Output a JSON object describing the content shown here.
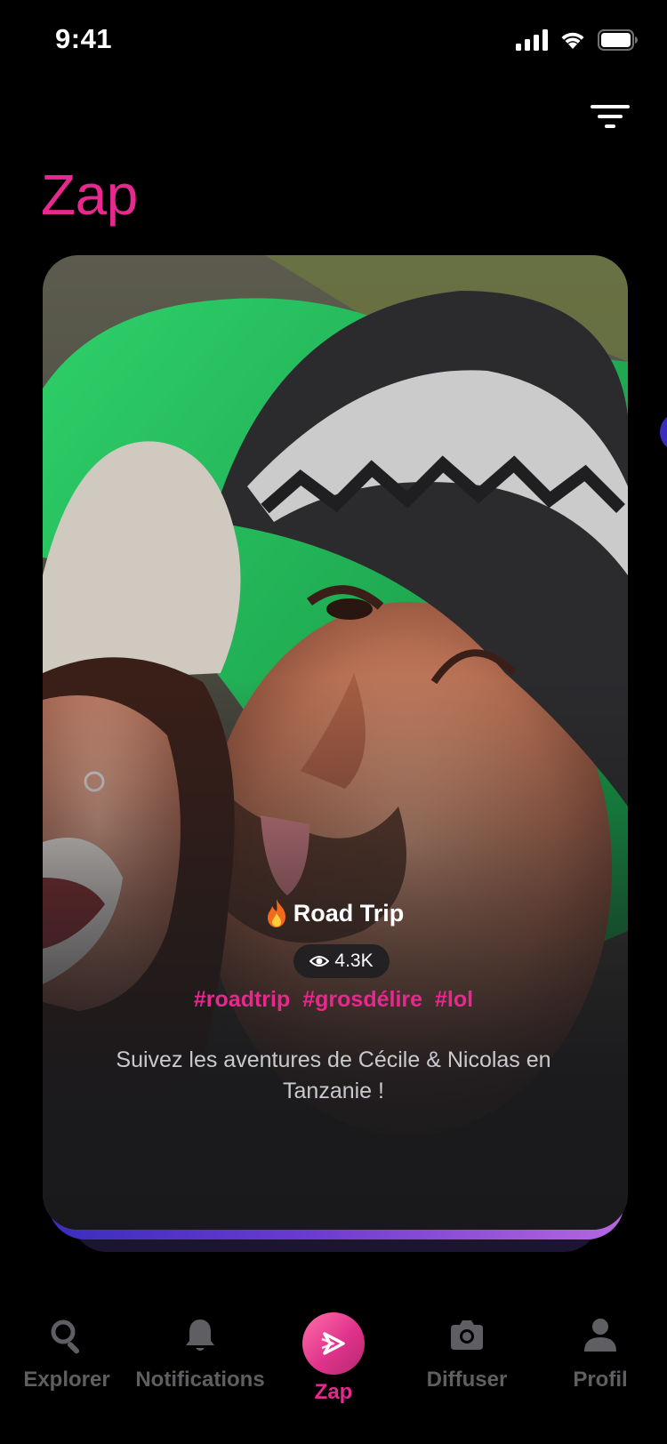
{
  "status_bar": {
    "time": "9:41",
    "icons": [
      "signal-icon",
      "wifi-icon",
      "battery-icon"
    ]
  },
  "header": {
    "title": "Zap",
    "filter_icon": "filter-icon"
  },
  "card": {
    "title": "Road Trip",
    "title_icon": "fire-icon",
    "views": "4.3K",
    "views_icon": "eye-icon",
    "tags": [
      "#roadtrip",
      "#grosdélire",
      "#lol"
    ],
    "description": "Suivez les aventures de Cécile & Nicolas en Tanzanie !"
  },
  "tab_bar": {
    "items": [
      {
        "label": "Explorer",
        "icon": "search-icon"
      },
      {
        "label": "Notifications",
        "icon": "bell-icon"
      },
      {
        "label": "Zap",
        "icon": "zap-icon",
        "active": true
      },
      {
        "label": "Diffuser",
        "icon": "camera-icon"
      },
      {
        "label": "Profil",
        "icon": "person-icon"
      }
    ]
  },
  "colors": {
    "accent": "#e7288e",
    "background": "#000000",
    "inactive": "#5e5e63",
    "stack_gradient_start": "#3a2dbd",
    "stack_gradient_end": "#b567df"
  }
}
